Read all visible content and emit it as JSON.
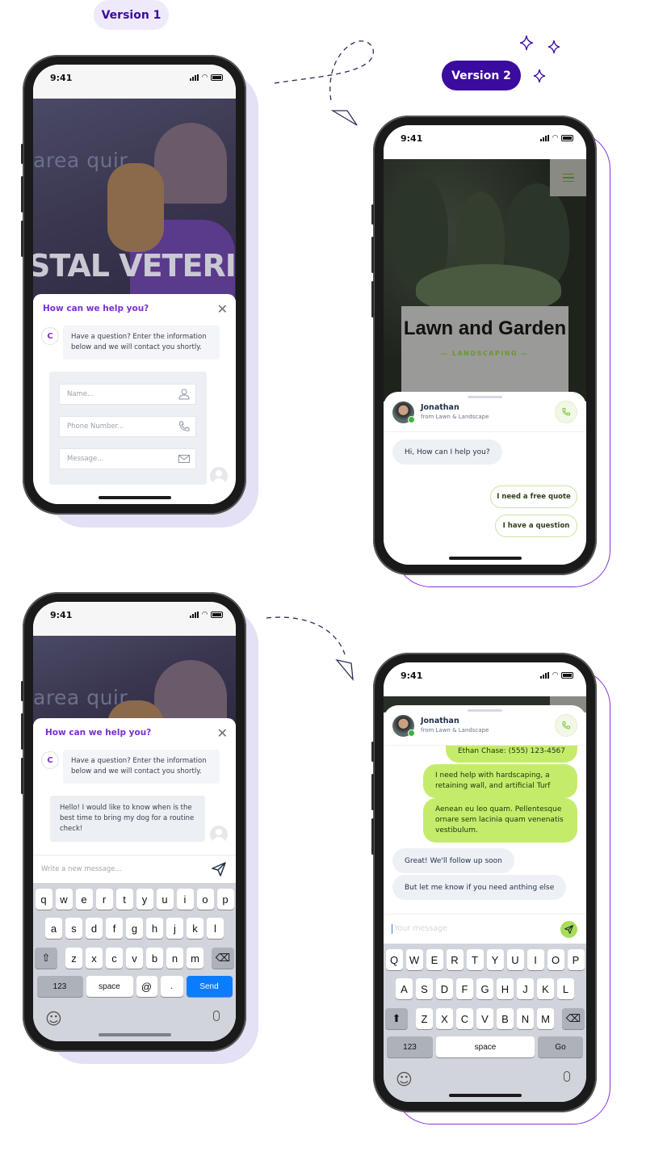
{
  "labels": {
    "version1": "Version 1",
    "version2": "Version 2"
  },
  "colors": {
    "accent_purple": "#7b2fd1",
    "version2_pill": "#3b0a9e",
    "version1_pill": "#eeeafc",
    "lime": "#c4ec6a",
    "ios_blue": "#0a7cff"
  },
  "status_time": "9:41",
  "v1_form": {
    "hero_text_top": "area quir",
    "hero_text_big": "STAL VETERII",
    "title": "How can we help you?",
    "avatar_letter": "C",
    "bot_message": "Have a question? Enter the information below and we will contact you shortly.",
    "fields": [
      {
        "placeholder": "Name...",
        "icon": "user-icon"
      },
      {
        "placeholder": "Phone Number...",
        "icon": "phone-icon"
      },
      {
        "placeholder": "Message...",
        "icon": "mail-icon"
      }
    ]
  },
  "v1_chat": {
    "hero_text_top": "area quir",
    "title": "How can we help you?",
    "avatar_letter": "C",
    "bot_message": "Have a question? Enter the information below and we will contact you shortly.",
    "user_message": "Hello! I would like to know when is the best time to bring my dog for a routine check!",
    "input_placeholder": "Write a new message...",
    "keyboard": {
      "rows": [
        [
          "q",
          "w",
          "e",
          "r",
          "t",
          "y",
          "u",
          "i",
          "o",
          "p"
        ],
        [
          "a",
          "s",
          "d",
          "f",
          "g",
          "h",
          "j",
          "k",
          "l"
        ],
        [
          "z",
          "x",
          "c",
          "v",
          "b",
          "n",
          "m"
        ]
      ],
      "numbers": "123",
      "space": "space",
      "at": "@",
      "dot": ".",
      "action": "Send"
    }
  },
  "v2_intro": {
    "hero_title": "Lawn and Garden",
    "hero_subtitle": "— LANDSCAPING —",
    "agent_name": "Jonathan",
    "agent_sub": "from Lawn & Landscape",
    "greeting": "Hi, How can I help you?",
    "quick_replies": [
      "I need a free quote",
      "I have a question"
    ]
  },
  "v2_chat": {
    "agent_name": "Jonathan",
    "agent_sub": "from Lawn & Landscape",
    "outgoing": [
      "Ethan Chase: (555) 123-4567",
      "I need help with hardscaping, a retaining wall, and artificial Turf",
      "Aenean eu leo quam. Pellentesque ornare sem lacinia quam venenatis vestibulum."
    ],
    "incoming": [
      "Great! We'll follow up soon",
      "But let me know if you need anthing else"
    ],
    "input_placeholder": "Your message",
    "keyboard": {
      "rows": [
        [
          "Q",
          "W",
          "E",
          "R",
          "T",
          "Y",
          "U",
          "I",
          "O",
          "P"
        ],
        [
          "A",
          "S",
          "D",
          "F",
          "G",
          "H",
          "J",
          "K",
          "L"
        ],
        [
          "Z",
          "X",
          "C",
          "V",
          "B",
          "N",
          "M"
        ]
      ],
      "numbers": "123",
      "space": "space",
      "action": "Go"
    }
  }
}
